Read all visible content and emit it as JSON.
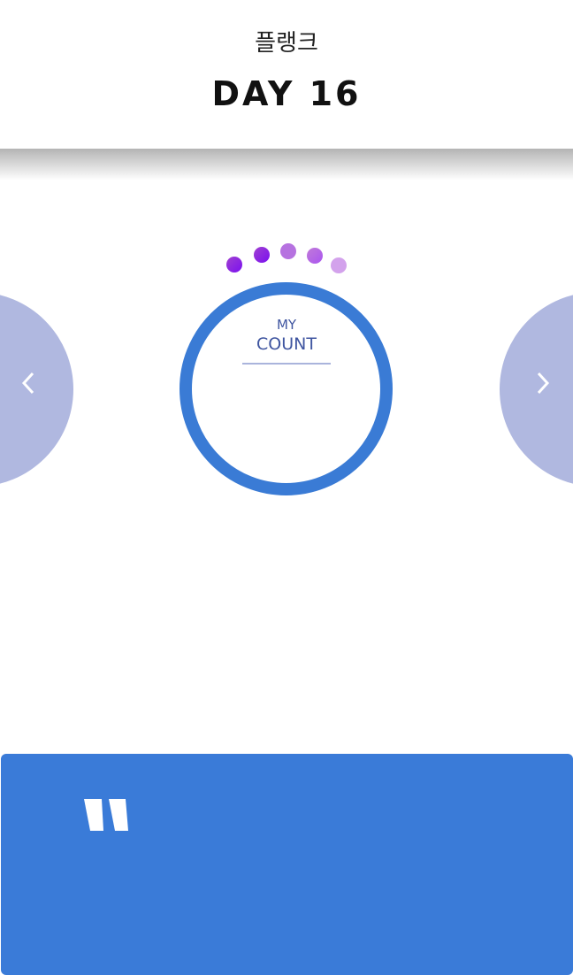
{
  "header": {
    "subtitle": "플랭크",
    "title": "DAY 16"
  },
  "nav": {
    "prev_icon": "chevron-left-icon",
    "next_icon": "chevron-right-icon"
  },
  "progress_dots": {
    "count": 5,
    "colors": [
      "#8a1ee0",
      "#8f1fe0",
      "#b672e0",
      "#b86ee6",
      "#d3a2ec"
    ]
  },
  "counter": {
    "label_top": "MY",
    "label_bottom": "COUNT",
    "ring_color": "#3a7bd5"
  },
  "quote_card": {
    "icon": "quote-icon",
    "color": "#3a7bd8"
  }
}
